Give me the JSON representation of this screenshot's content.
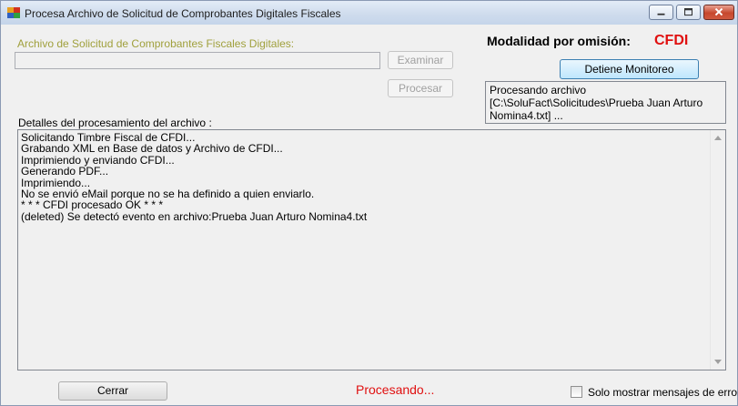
{
  "window": {
    "title": "Procesa Archivo de Solicitud de Comprobantes Digitales Fiscales"
  },
  "form": {
    "archivo_label": "Archivo de Solicitud de Comprobantes Fiscales Digitales:",
    "archivo_value": "",
    "examinar_label": "Examinar",
    "procesar_label": "Procesar",
    "modalidad_label": "Modalidad por omisión:",
    "modalidad_value": "CFDI",
    "detiene_label": "Detiene Monitoreo",
    "status_text": "Procesando archivo [C:\\SoluFact\\Solicitudes\\Prueba Juan Arturo Nomina4.txt] ...",
    "detalles_label": "Detalles del procesamiento del archivo :",
    "log_lines": [
      "Solicitando Timbre Fiscal de CFDI...",
      "Grabando XML en Base de datos y Archivo de CFDI...",
      "Imprimiendo y enviando CFDI...",
      "Generando PDF...",
      "Imprimiendo...",
      "No se envió eMail porque no se ha definido a quien enviarlo.",
      "* * * CFDI procesado OK * * *",
      "(deleted) Se detectó evento en archivo:Prueba Juan Arturo Nomina4.txt"
    ]
  },
  "footer": {
    "cerrar_label": "Cerrar",
    "procesando_text": "Procesando...",
    "solo_errores_label": "Solo mostrar mensajes de error",
    "solo_errores_checked": false
  },
  "icons": {
    "app": "app-icon",
    "minimize": "minimize-icon",
    "maximize": "maximize-icon",
    "close": "close-icon",
    "scroll_up": "scroll-up-arrow-icon",
    "scroll_down": "scroll-down-arrow-icon"
  },
  "colors": {
    "accent_red": "#e01010",
    "label_olive": "#a0a03c"
  }
}
